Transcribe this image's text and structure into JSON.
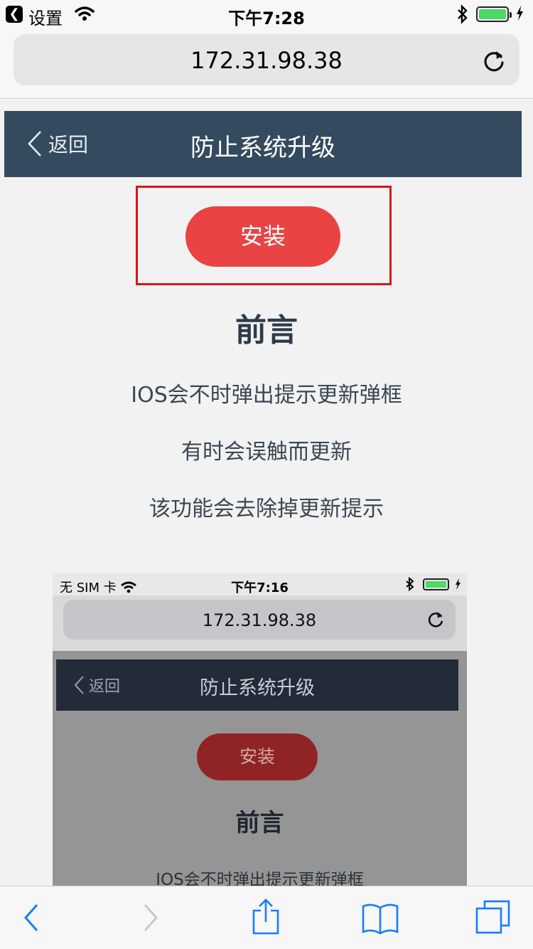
{
  "status_bar": {
    "back_app_label": "设置",
    "time": "下午7:28",
    "battery_level": 1.0
  },
  "browser": {
    "url": "172.31.98.38"
  },
  "page": {
    "nav": {
      "back_label": "返回",
      "title": "防止系统升级"
    },
    "install_label": "安装",
    "heading": "前言",
    "paragraphs": [
      "IOS会不时弹出提示更新弹框",
      "有时会误触而更新",
      "该功能会去除掉更新提示"
    ],
    "screenshot": {
      "carrier": "无 SIM 卡",
      "time": "下午7:16",
      "url": "172.31.98.38",
      "back_label": "返回",
      "title": "防止系统升级",
      "install_label": "安装",
      "heading": "前言",
      "paragraph": "IOS会不时弹出提示更新弹框"
    }
  },
  "colors": {
    "navbar": "#344a5e",
    "install_button": "#e94343",
    "highlight_border": "#e0131b",
    "toolbar_icon": "#157efb"
  },
  "toolbar": {
    "icons": [
      "back-icon",
      "forward-icon",
      "share-icon",
      "bookmarks-icon",
      "tabs-icon"
    ]
  }
}
